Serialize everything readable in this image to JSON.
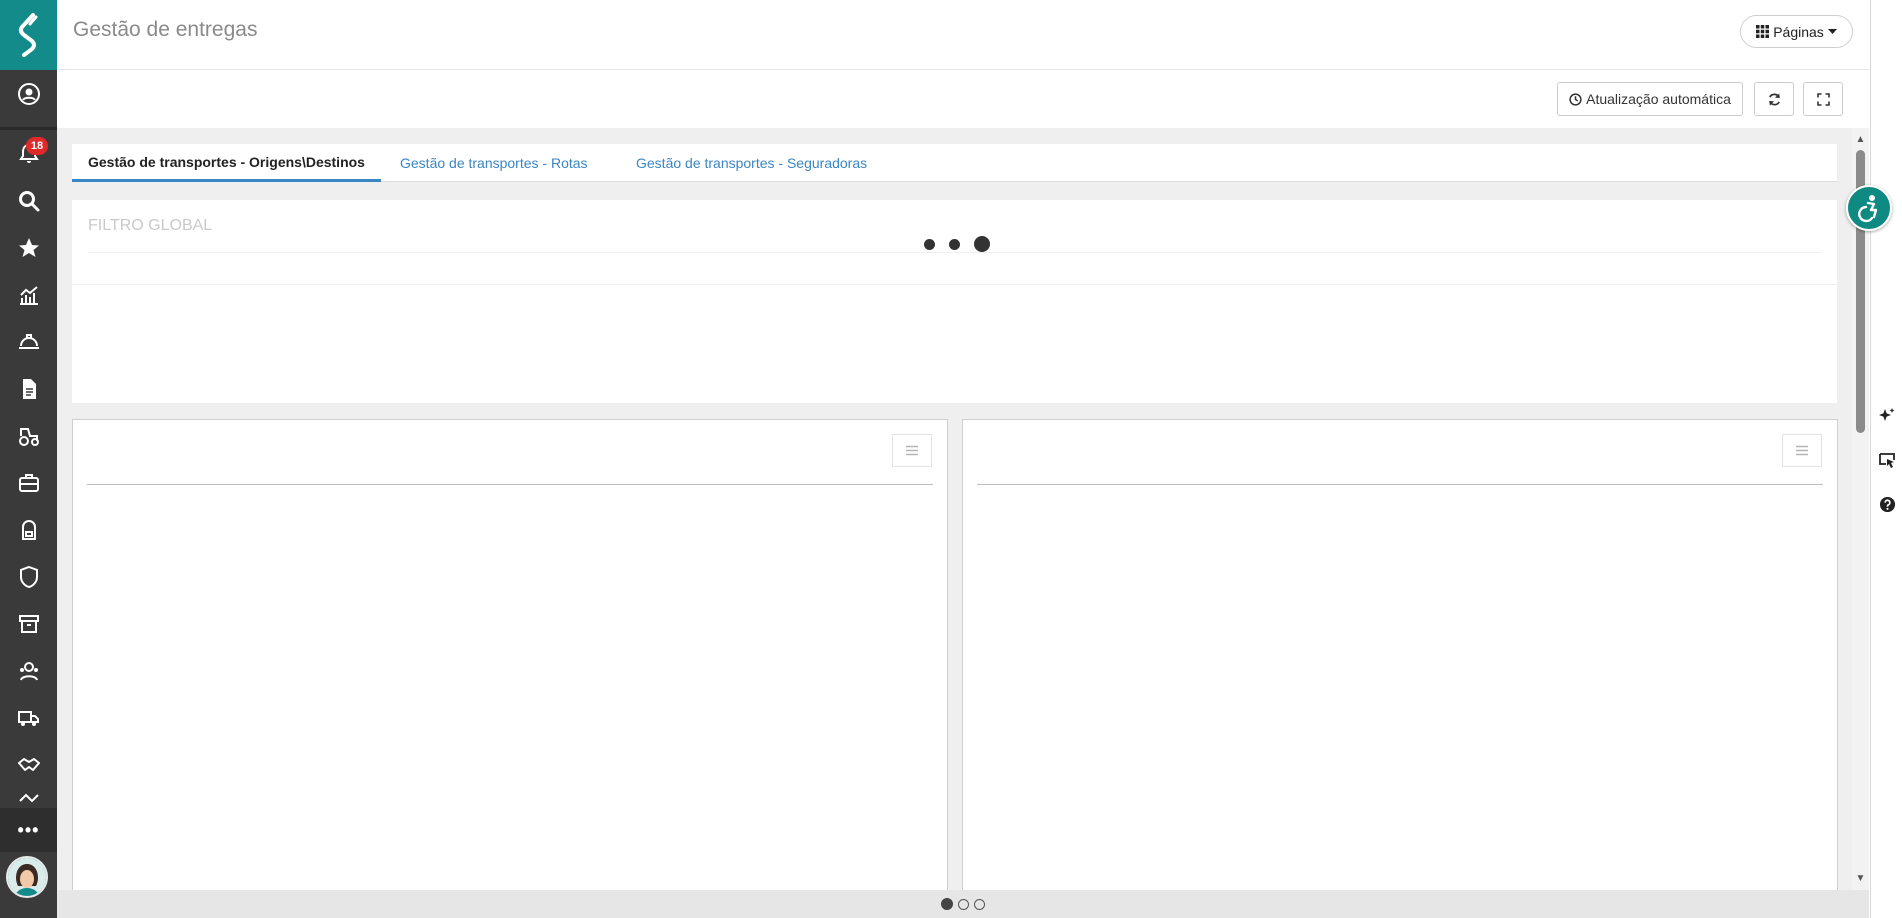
{
  "header": {
    "title": "Gestão de entregas",
    "pages_button": "Páginas"
  },
  "sidebar": {
    "notification_count": "18",
    "more_label": "•••"
  },
  "toolbar": {
    "auto_update_label": "Atualização automática"
  },
  "tabs": [
    {
      "label": "Gestão de transportes - Origens\\Destinos",
      "active": true
    },
    {
      "label": "Gestão de transportes - Rotas",
      "active": false
    },
    {
      "label": "Gestão de transportes - Seguradoras",
      "active": false
    }
  ],
  "filter": {
    "title": "FILTRO GLOBAL"
  },
  "pager": {
    "pages": 3,
    "active_index": 0
  },
  "colors": {
    "brand": "#138b8a",
    "sidebar": "#3a3a3a",
    "tab_accent": "#3b86c4",
    "badge": "#e02a2a"
  }
}
